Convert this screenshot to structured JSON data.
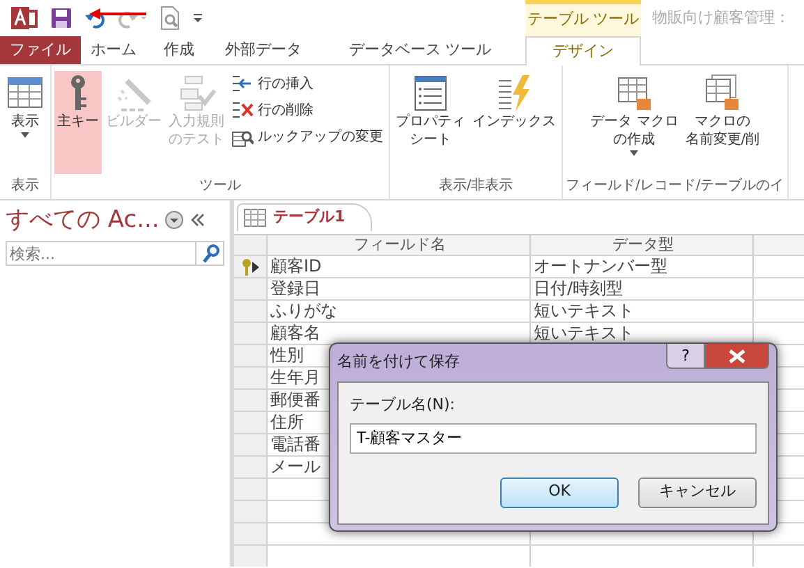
{
  "contextual_tab_group": "テーブル ツール",
  "window_title": "物販向け顧客管理：",
  "tabs": [
    {
      "label": "ファイル",
      "kind": "file",
      "selected": false
    },
    {
      "label": "ホーム",
      "kind": "normal",
      "selected": false
    },
    {
      "label": "作成",
      "kind": "normal",
      "selected": false
    },
    {
      "label": "外部データ",
      "kind": "normal",
      "selected": false
    },
    {
      "label": "データベース ツール",
      "kind": "normal",
      "selected": false
    },
    {
      "label": "デザイン",
      "kind": "normal",
      "selected": true
    }
  ],
  "ribbon_groups": [
    {
      "label": "表示",
      "items": [
        {
          "kind": "large",
          "lines": [
            "表示"
          ],
          "dropdown": true,
          "disabled": false,
          "selected": false
        }
      ]
    },
    {
      "label": "ツール",
      "items": [
        {
          "kind": "large",
          "lines": [
            "主キー"
          ],
          "dropdown": false,
          "disabled": false,
          "selected": true
        },
        {
          "kind": "large",
          "lines": [
            "ビルダー"
          ],
          "dropdown": false,
          "disabled": true,
          "selected": false
        },
        {
          "kind": "large",
          "lines": [
            "入力規則",
            "のテスト"
          ],
          "dropdown": false,
          "disabled": true,
          "selected": false
        },
        {
          "kind": "small_stack",
          "buttons": [
            {
              "label": "行の挿入"
            },
            {
              "label": "行の削除"
            },
            {
              "label": "ルックアップの変更"
            }
          ]
        }
      ]
    },
    {
      "label": "表示/非表示",
      "items": [
        {
          "kind": "large",
          "lines": [
            "プロパティ",
            "シート"
          ],
          "dropdown": false,
          "disabled": false,
          "selected": false
        },
        {
          "kind": "large",
          "lines": [
            "インデックス"
          ],
          "dropdown": false,
          "disabled": false,
          "selected": false
        }
      ]
    },
    {
      "label": "フィールド/レコード/テーブルのイ",
      "items": [
        {
          "kind": "large",
          "lines": [
            "データ マクロ",
            "の作成"
          ],
          "dropdown": true,
          "disabled": false,
          "selected": false
        },
        {
          "kind": "large",
          "lines": [
            "マクロの",
            "名前変更/削"
          ],
          "dropdown": false,
          "disabled": false,
          "selected": false
        }
      ]
    }
  ],
  "nav_pane": {
    "title": "すべての Ac...",
    "search": {
      "placeholder": "検索..."
    }
  },
  "document_tabs": [
    {
      "label": "テーブル1",
      "selected": true
    }
  ],
  "table": {
    "columns": [
      "フィールド名",
      "データ型"
    ],
    "rows": [
      {
        "field": "顧客ID",
        "type": "オートナンバー型",
        "primary_key": true,
        "current": true
      },
      {
        "field": "登録日",
        "type": "日付/時刻型",
        "primary_key": false,
        "current": false
      },
      {
        "field": "ふりがな",
        "type": "短いテキスト",
        "primary_key": false,
        "current": false
      },
      {
        "field": "顧客名",
        "type": "短いテキスト",
        "primary_key": false,
        "current": false
      },
      {
        "field": "性別",
        "primary_key": false,
        "current": false
      },
      {
        "field": "生年月",
        "primary_key": false,
        "current": false
      },
      {
        "field": "郵便番",
        "primary_key": false,
        "current": false
      },
      {
        "field": "住所",
        "primary_key": false,
        "current": false
      },
      {
        "field": "電話番",
        "primary_key": false,
        "current": false
      },
      {
        "field": "メール",
        "primary_key": false,
        "current": false
      }
    ]
  },
  "dialog": {
    "title": "名前を付けて保存",
    "help": "?",
    "label": "テーブル名(N):",
    "value": "T-顧客マスター",
    "buttons": [
      {
        "label": "OK",
        "default": true
      },
      {
        "label": "キャンセル",
        "default": false
      }
    ]
  }
}
